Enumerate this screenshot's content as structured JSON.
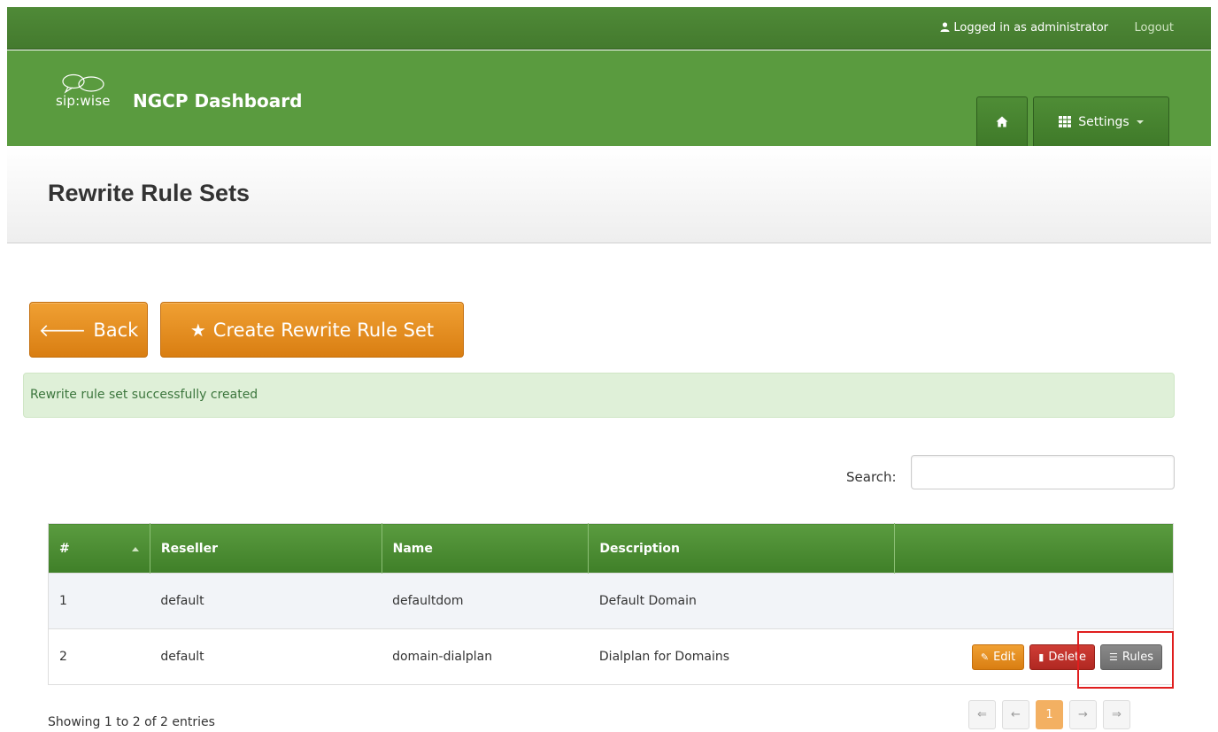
{
  "topbar": {
    "user_text": "Logged in as administrator",
    "logout_label": "Logout"
  },
  "brand": {
    "logo_text": "sip:wise",
    "title": "NGCP Dashboard"
  },
  "nav": {
    "settings_label": "Settings"
  },
  "page": {
    "title": "Rewrite Rule Sets"
  },
  "actions": {
    "back_label": "Back",
    "create_label": "Create Rewrite Rule Set"
  },
  "alert": {
    "text": "Rewrite rule set successfully created"
  },
  "search": {
    "label": "Search:",
    "value": ""
  },
  "table": {
    "headers": [
      "#",
      "Reseller",
      "Name",
      "Description",
      ""
    ],
    "rows": [
      {
        "id": "1",
        "reseller": "default",
        "name": "defaultdom",
        "description": "Default Domain"
      },
      {
        "id": "2",
        "reseller": "default",
        "name": "domain-dialplan",
        "description": "Dialplan for Domains"
      }
    ],
    "row_actions": {
      "edit_label": "Edit",
      "delete_label": "Delete",
      "rules_label": "Rules"
    }
  },
  "footer": {
    "info": "Showing 1 to 2 of 2 entries",
    "pager": {
      "first": "⇐",
      "prev": "←",
      "current": "1",
      "next": "→",
      "last": "⇒"
    }
  },
  "colors": {
    "brand_green": "#5a9b3f",
    "topbar_green": "#4a8233",
    "accent_orange": "#e8921f",
    "danger_red": "#c0322b",
    "alert_green": "#dff0d8"
  },
  "icons": [
    "user-icon",
    "home-icon",
    "grid-icon",
    "arrow-left-icon",
    "star-icon",
    "edit-icon",
    "trash-icon",
    "list-icon"
  ]
}
